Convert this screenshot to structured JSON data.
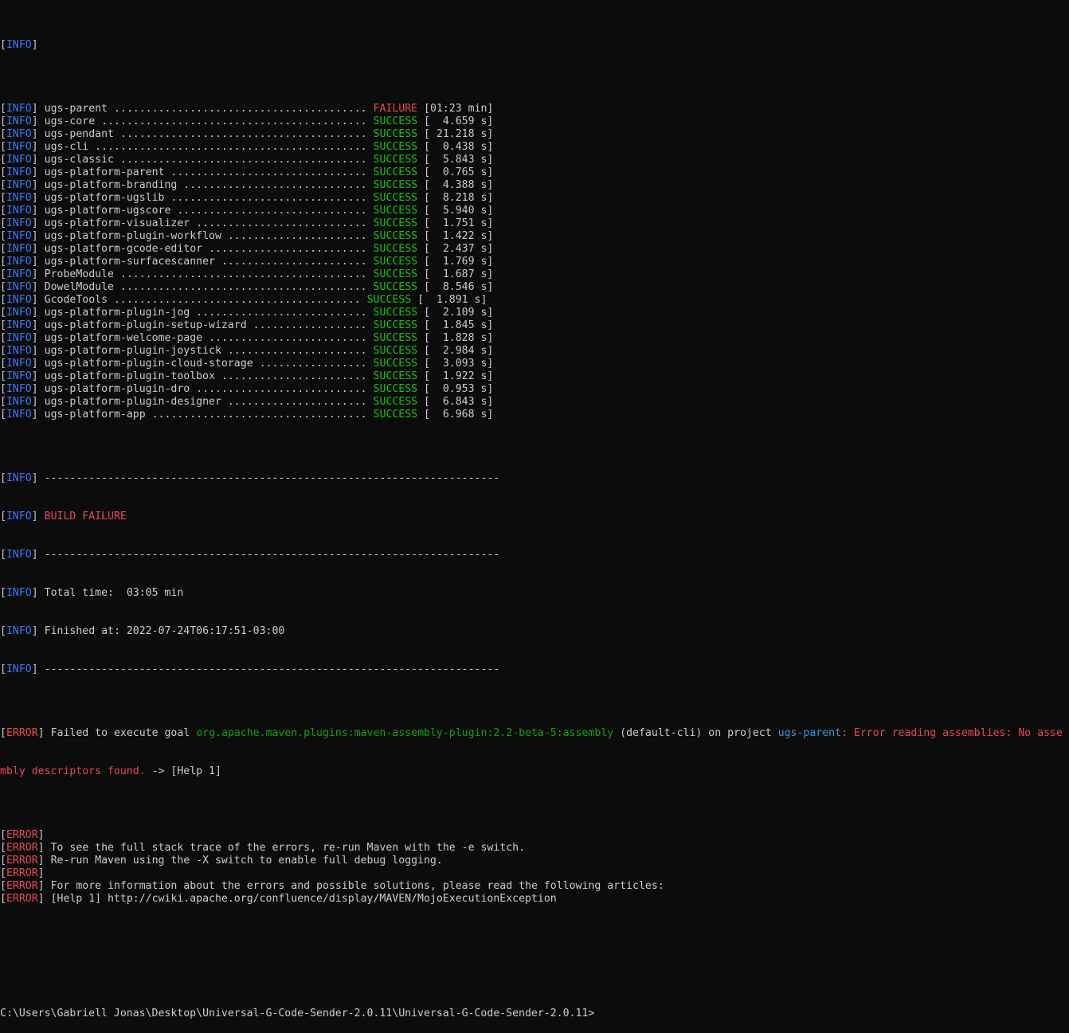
{
  "info_tag": "INFO",
  "error_tag": "ERROR",
  "first_line": "",
  "modules": [
    {
      "name": "ugs-parent ........................................",
      "status": "FAILURE",
      "time": "[01:23 min]"
    },
    {
      "name": "ugs-core ..........................................",
      "status": "SUCCESS",
      "time": "[  4.659 s]"
    },
    {
      "name": "ugs-pendant .......................................",
      "status": "SUCCESS",
      "time": "[ 21.218 s]"
    },
    {
      "name": "ugs-cli ...........................................",
      "status": "SUCCESS",
      "time": "[  0.438 s]"
    },
    {
      "name": "ugs-classic .......................................",
      "status": "SUCCESS",
      "time": "[  5.843 s]"
    },
    {
      "name": "ugs-platform-parent ...............................",
      "status": "SUCCESS",
      "time": "[  0.765 s]"
    },
    {
      "name": "ugs-platform-branding .............................",
      "status": "SUCCESS",
      "time": "[  4.388 s]"
    },
    {
      "name": "ugs-platform-ugslib ...............................",
      "status": "SUCCESS",
      "time": "[  8.218 s]"
    },
    {
      "name": "ugs-platform-ugscore ..............................",
      "status": "SUCCESS",
      "time": "[  5.940 s]"
    },
    {
      "name": "ugs-platform-visualizer ...........................",
      "status": "SUCCESS",
      "time": "[  1.751 s]"
    },
    {
      "name": "ugs-platform-plugin-workflow ......................",
      "status": "SUCCESS",
      "time": "[  1.422 s]"
    },
    {
      "name": "ugs-platform-gcode-editor .........................",
      "status": "SUCCESS",
      "time": "[  2.437 s]"
    },
    {
      "name": "ugs-platform-surfacescanner .......................",
      "status": "SUCCESS",
      "time": "[  1.769 s]"
    },
    {
      "name": "ProbeModule .......................................",
      "status": "SUCCESS",
      "time": "[  1.687 s]"
    },
    {
      "name": "DowelModule .......................................",
      "status": "SUCCESS",
      "time": "[  8.546 s]"
    },
    {
      "name": "GcodeTools .......................................",
      "status": "SUCCESS",
      "time": "[  1.891 s]"
    },
    {
      "name": "ugs-platform-plugin-jog ...........................",
      "status": "SUCCESS",
      "time": "[  2.109 s]"
    },
    {
      "name": "ugs-platform-plugin-setup-wizard ..................",
      "status": "SUCCESS",
      "time": "[  1.845 s]"
    },
    {
      "name": "ugs-platform-welcome-page .........................",
      "status": "SUCCESS",
      "time": "[  1.828 s]"
    },
    {
      "name": "ugs-platform-plugin-joystick ......................",
      "status": "SUCCESS",
      "time": "[  2.984 s]"
    },
    {
      "name": "ugs-platform-plugin-cloud-storage .................",
      "status": "SUCCESS",
      "time": "[  3.093 s]"
    },
    {
      "name": "ugs-platform-plugin-toolbox .......................",
      "status": "SUCCESS",
      "time": "[  1.922 s]"
    },
    {
      "name": "ugs-platform-plugin-dro ...........................",
      "status": "SUCCESS",
      "time": "[  0.953 s]"
    },
    {
      "name": "ugs-platform-plugin-designer ......................",
      "status": "SUCCESS",
      "time": "[  6.843 s]"
    },
    {
      "name": "ugs-platform-app ..................................",
      "status": "SUCCESS",
      "time": "[  6.968 s]"
    }
  ],
  "separator": "------------------------------------------------------------------------",
  "build_result": "BUILD FAILURE",
  "total_time": "Total time:  03:05 min",
  "finished_at": "Finished at: 2022-07-24T06:17:51-03:00",
  "error_main": {
    "prefix": "Failed to execute goal ",
    "goal": "org.apache.maven.plugins:maven-assembly-plugin:2.2-beta-5:assembly",
    "middle": " (default-cli) on project ",
    "project": "ugs-parent",
    "message_part1": ": Error reading assemblies: No asse",
    "message_part2": "mbly descriptors found.",
    "help_ref": " -> [Help 1]"
  },
  "error_lines": [
    "",
    "To see the full stack trace of the errors, re-run Maven with the -e switch.",
    "Re-run Maven using the -X switch to enable full debug logging.",
    "",
    "For more information about the errors and possible solutions, please read the following articles:",
    "[Help 1] http://cwiki.apache.org/confluence/display/MAVEN/MojoExecutionException"
  ],
  "prompt": "C:\\Users\\Gabriell Jonas\\Desktop\\Universal-G-Code-Sender-2.0.11\\Universal-G-Code-Sender-2.0.11>",
  "colors": {
    "background": "#0c0c0c",
    "text": "#cccccc",
    "info": "#3b78ff",
    "error": "#e74856",
    "success": "#16c60c",
    "goal": "#13a10e",
    "project": "#3a96dd"
  }
}
